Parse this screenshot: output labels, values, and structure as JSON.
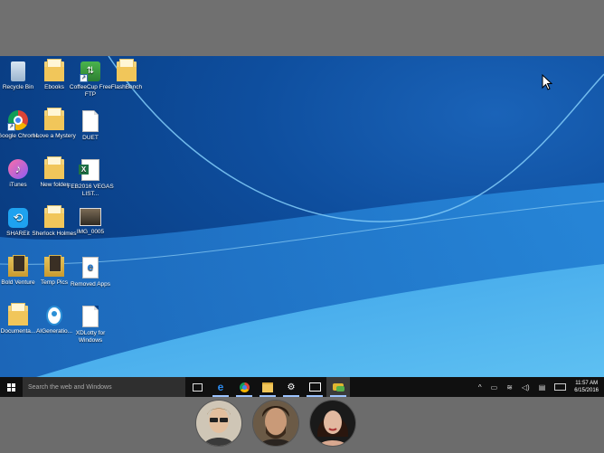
{
  "desktop": {
    "icons": [
      {
        "label": "Recycle Bin",
        "icon": "recycle-bin-icon"
      },
      {
        "label": "Ebooks",
        "icon": "folder-icon"
      },
      {
        "label": "CoffeeCup Free FTP",
        "icon": "ftp-app-icon"
      },
      {
        "label": "FlashBench",
        "icon": "folder-icon"
      },
      {
        "label": "Google Chrome",
        "icon": "chrome-icon"
      },
      {
        "label": "I Love a Mystery",
        "icon": "folder-icon"
      },
      {
        "label": "DUET",
        "icon": "document-icon"
      },
      {
        "label": "iTunes",
        "icon": "itunes-icon"
      },
      {
        "label": "New folder",
        "icon": "folder-icon"
      },
      {
        "label": "FEB2016 VEGAS LIST...",
        "icon": "excel-file-icon"
      },
      {
        "label": "SHAREit",
        "icon": "shareit-icon"
      },
      {
        "label": "Sherlock Holmes",
        "icon": "folder-icon"
      },
      {
        "label": "IMG_0005",
        "icon": "image-file-icon"
      },
      {
        "label": "Bold Venture",
        "icon": "folder-icon"
      },
      {
        "label": "Temp Pics",
        "icon": "folder-icon"
      },
      {
        "label": "Removed Apps",
        "icon": "edge-document-icon"
      },
      {
        "label": "Documenta...",
        "icon": "folder-icon"
      },
      {
        "label": "AIGeneratio...",
        "icon": "target-app-icon"
      },
      {
        "label": "XDLotty for Windows",
        "icon": "document-icon"
      }
    ]
  },
  "taskbar": {
    "search_placeholder": "Search the web and Windows",
    "apps": [
      "task-view-icon",
      "edge-icon",
      "chrome-icon",
      "file-explorer-icon",
      "settings-icon",
      "mail-icon",
      "chat-app-icon"
    ],
    "clock_time": "11:57 AM",
    "clock_date": "6/15/2016"
  },
  "participants": [
    {
      "name": "participant-1"
    },
    {
      "name": "participant-2"
    },
    {
      "name": "participant-3"
    }
  ],
  "colors": {
    "wallpaper": "#0e4e9e",
    "taskbar": "#101010",
    "frame": "#6e6e6e"
  }
}
